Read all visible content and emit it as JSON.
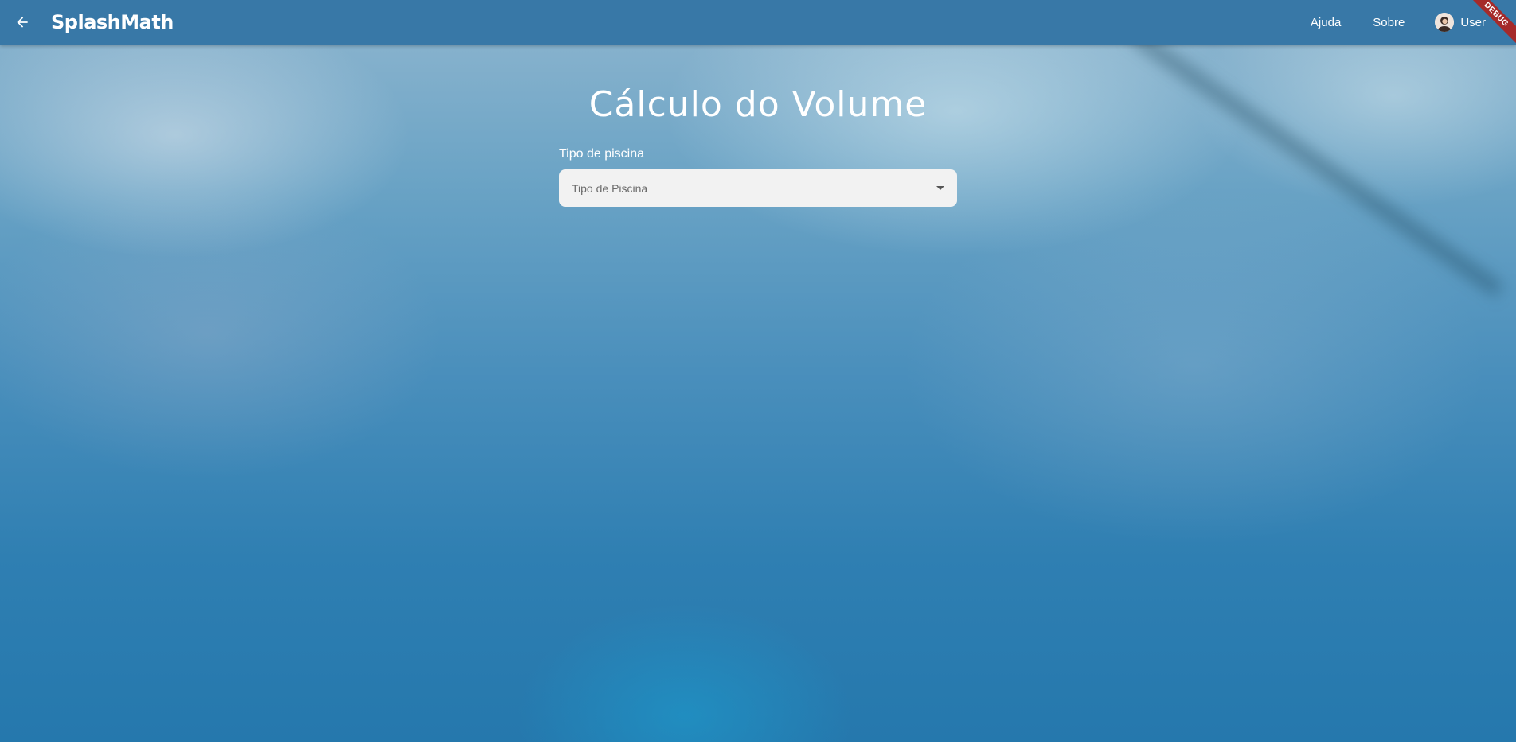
{
  "appbar": {
    "title": "SplashMath",
    "back_icon": "arrow-left-icon",
    "nav": [
      {
        "label": "Ajuda"
      },
      {
        "label": "Sobre"
      }
    ],
    "user": {
      "label": "User",
      "avatar_icon": "avatar"
    },
    "debug_banner": "DEBUG",
    "color": "#3878a7"
  },
  "main": {
    "title": "Cálculo do Volume",
    "pool_type": {
      "label": "Tipo de piscina",
      "placeholder": "Tipo de Piscina",
      "dropdown_icon": "caret-down-icon"
    }
  }
}
